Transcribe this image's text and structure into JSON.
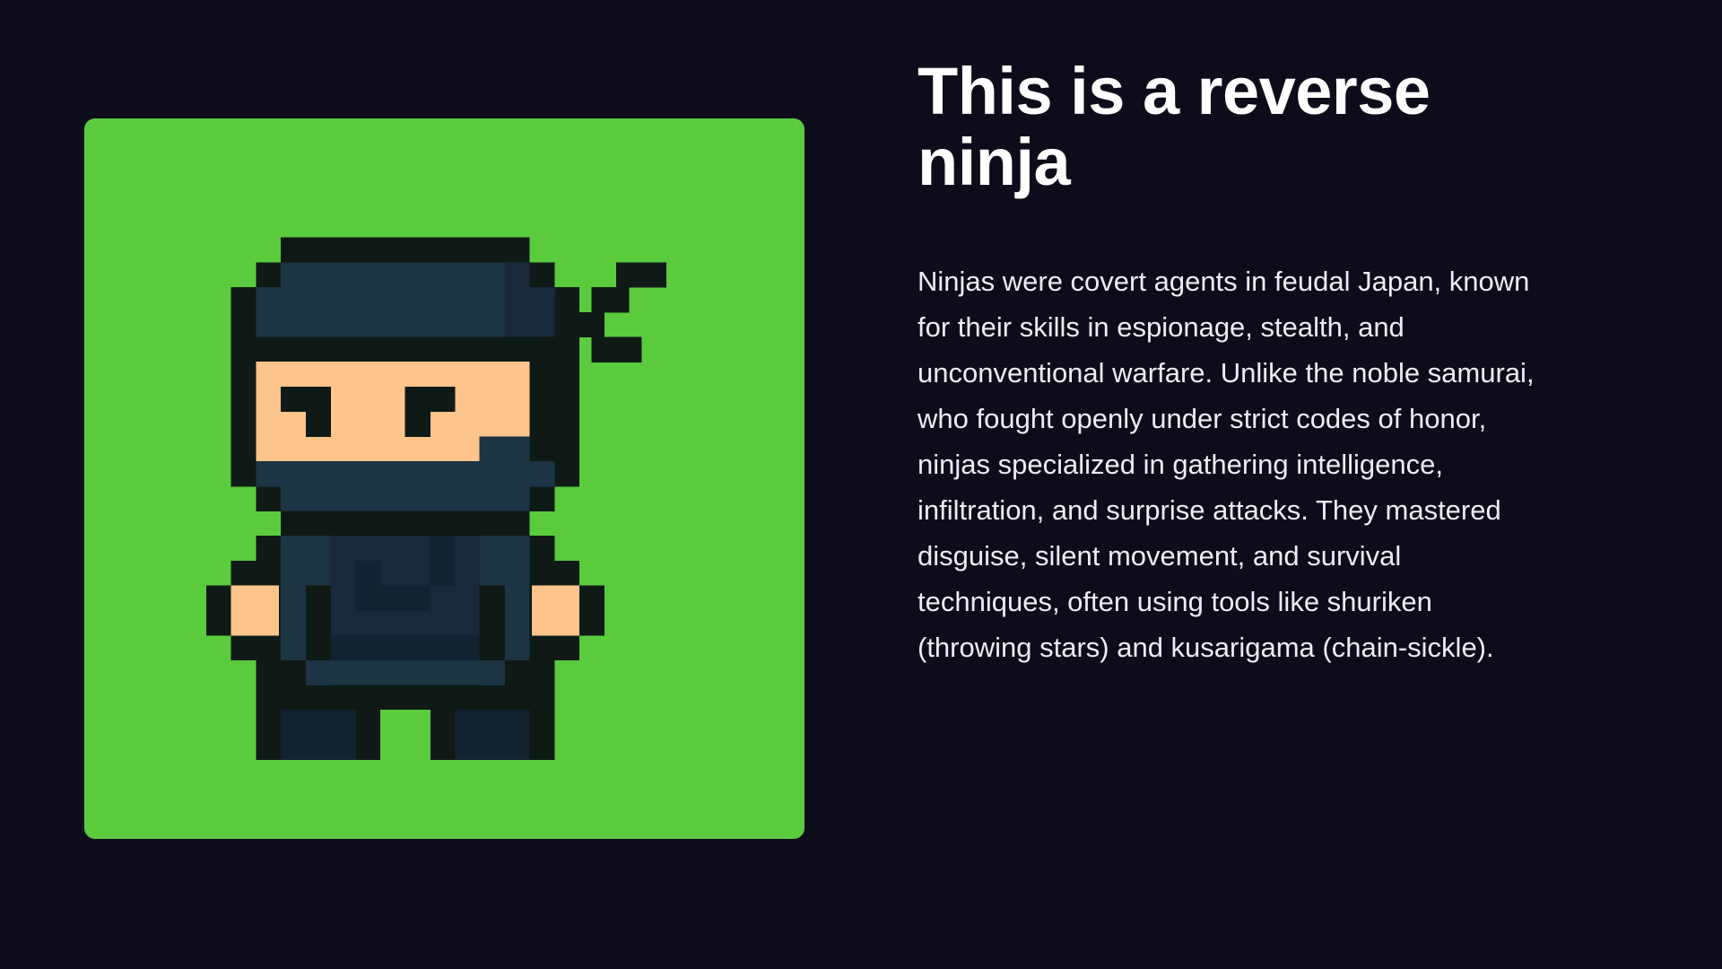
{
  "hero": {
    "title": "This is a reverse ninja",
    "body": "Ninjas were covert agents in feudal Japan, known for their skills in espionage, stealth, and unconventional warfare. Unlike the noble samurai, who fought openly under strict codes of honor, ninjas specialized in gathering intelligence, infiltration, and surprise attacks. They mastered disguise, silent movement, and survival techniques, often using tools like shuriken (throwing stars) and kusarigama (chain-sickle)."
  },
  "illustration": {
    "icon": "pixel-ninja-icon",
    "colors": {
      "background": "#5bcb3e",
      "outline": "#0f1a16",
      "suit": "#1c3444",
      "suit_shade": "#17293a",
      "suit_dark": "#122230",
      "skin": "#fdc48c"
    }
  },
  "theme": {
    "page_background": "#0c0c1b",
    "text_color": "#ffffff"
  }
}
